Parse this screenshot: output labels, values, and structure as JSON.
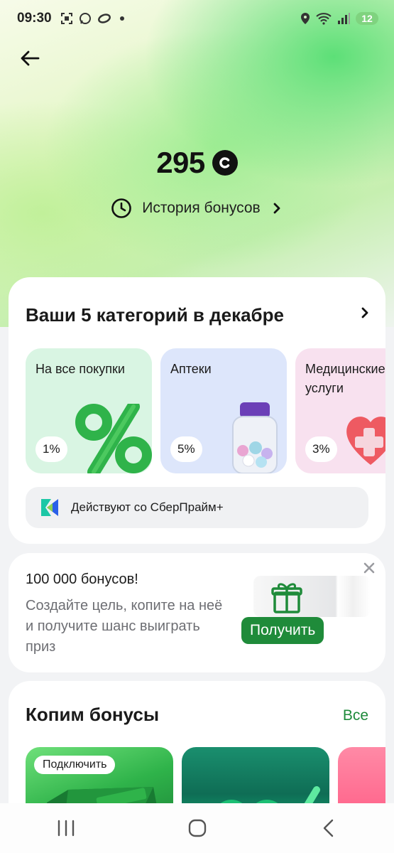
{
  "status_bar": {
    "time": "09:30",
    "battery": "12"
  },
  "header": {
    "back_icon": "arrow-left-icon"
  },
  "balance": {
    "value": "295",
    "currency_icon": "sber-coin-icon"
  },
  "history": {
    "label": "История бонусов"
  },
  "categories": {
    "title": "Ваши 5 категорий в декабре",
    "tiles": [
      {
        "label": "На все покупки",
        "percent": "1%",
        "bg": "#d9f5e3"
      },
      {
        "label": "Аптеки",
        "percent": "5%",
        "bg": "#dde6fb"
      },
      {
        "label": "Медицинские услуги",
        "percent": "3%",
        "bg": "#f8e1ef"
      }
    ],
    "prime_label": "Действуют со СберПрайм+"
  },
  "promo": {
    "title": "100 000 бонусов!",
    "text": "Создайте цель, копите на неё и получите шанс выиграть приз",
    "button": "Получить"
  },
  "save": {
    "title": "Копим бонусы",
    "all_link": "Все",
    "offers": [
      {
        "badge": "Подключить"
      }
    ]
  },
  "colors": {
    "accent_green": "#1f8b3a",
    "link_green": "#1d8a3a"
  }
}
